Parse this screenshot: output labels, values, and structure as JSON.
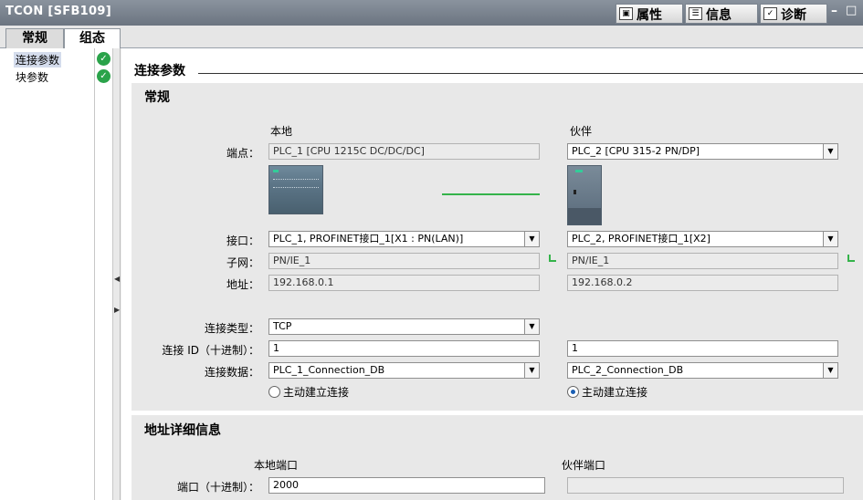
{
  "window": {
    "title": "TCON [SFB109]",
    "tabs": [
      {
        "label": "属性",
        "icon": "properties-icon"
      },
      {
        "label": "信息",
        "icon": "info-icon"
      },
      {
        "label": "诊断",
        "icon": "diagnostics-icon"
      }
    ],
    "info_badge": "i"
  },
  "left_tabs": [
    "常规",
    "组态"
  ],
  "nav": {
    "items": [
      {
        "label": "连接参数",
        "status": "ok"
      },
      {
        "label": "块参数",
        "status": "ok"
      }
    ]
  },
  "main": {
    "title": "连接参数",
    "general": {
      "title": "常规",
      "local_header": "本地",
      "partner_header": "伙伴",
      "endpoint_label": "端点：",
      "local_endpoint": "PLC_1 [CPU 1215C DC/DC/DC]",
      "partner_endpoint": "PLC_2 [CPU 315-2 PN/DP]",
      "interface_label": "接口：",
      "local_interface": "PLC_1, PROFINET接口_1[X1 : PN(LAN)]",
      "partner_interface": "PLC_2, PROFINET接口_1[X2]",
      "subnet_label": "子网：",
      "local_subnet": "PN/IE_1",
      "partner_subnet": "PN/IE_1",
      "address_label": "地址：",
      "local_address": "192.168.0.1",
      "partner_address": "192.168.0.2",
      "conn_type_label": "连接类型：",
      "conn_type": "TCP",
      "conn_id_label": "连接 ID（十进制）：",
      "local_conn_id": "1",
      "partner_conn_id": "1",
      "conn_data_label": "连接数据：",
      "local_conn_data": "PLC_1_Connection_DB",
      "partner_conn_data": "PLC_2_Connection_DB",
      "local_active_label": "主动建立连接",
      "partner_active_label": "主动建立连接",
      "local_active": false,
      "partner_active": true
    },
    "address_details": {
      "title": "地址详细信息",
      "local_port_header": "本地端口",
      "partner_port_header": "伙伴端口",
      "port_label": "端口（十进制）：",
      "local_port": "2000",
      "partner_port": ""
    }
  },
  "colors": {
    "ok": "#2aa34a",
    "link": "#34b34a",
    "titlebar": "#7a838e"
  }
}
